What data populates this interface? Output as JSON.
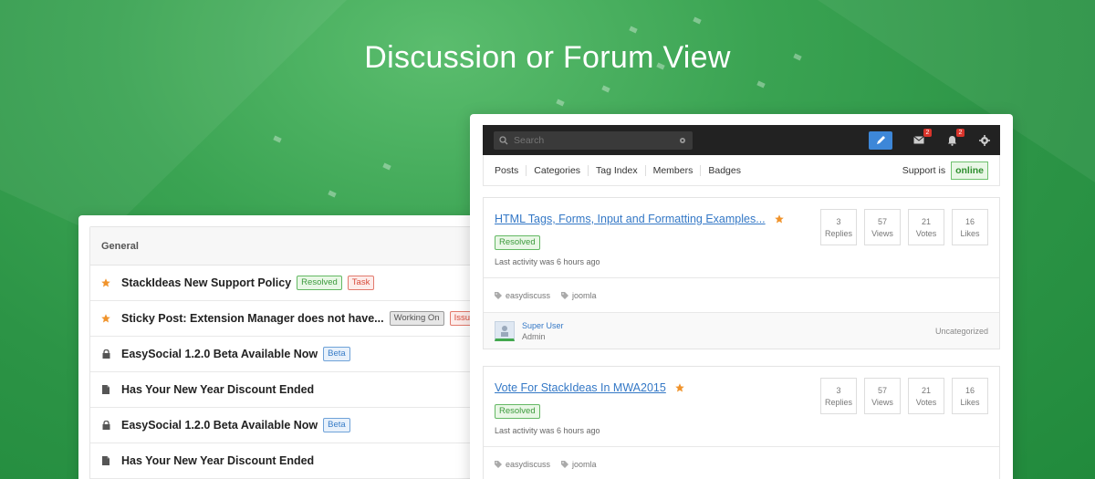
{
  "headline": "Discussion or Forum View",
  "left": {
    "header": "General",
    "rows": [
      {
        "icon": "star-icon",
        "title": "StackIdeas New Support Policy",
        "labels": [
          {
            "text": "Resolved",
            "kind": "resolved"
          },
          {
            "text": "Task",
            "kind": "task"
          }
        ]
      },
      {
        "icon": "star-icon",
        "title": "Sticky Post: Extension Manager does not have...",
        "labels": [
          {
            "text": "Working On",
            "kind": "working"
          },
          {
            "text": "Issue",
            "kind": "issue"
          }
        ]
      },
      {
        "icon": "lock-icon",
        "title": "EasySocial 1.2.0 Beta Available Now",
        "labels": [
          {
            "text": "Beta",
            "kind": "beta"
          }
        ]
      },
      {
        "icon": "document-icon",
        "title": "Has Your New Year Discount Ended",
        "labels": []
      },
      {
        "icon": "lock-icon",
        "title": "EasySocial 1.2.0 Beta Available Now",
        "labels": [
          {
            "text": "Beta",
            "kind": "beta"
          }
        ]
      },
      {
        "icon": "document-icon",
        "title": "Has Your New Year Discount Ended",
        "labels": []
      }
    ]
  },
  "toolbar": {
    "search_placeholder": "Search",
    "mail_count": "2",
    "notif_count": "2"
  },
  "subnav": {
    "items": [
      "Posts",
      "Categories",
      "Tag Index",
      "Members",
      "Badges"
    ],
    "support_label": "Support is",
    "support_status": "online"
  },
  "posts": [
    {
      "title": "HTML Tags, Forms, Input and Formatting Examples...",
      "status": "Resolved",
      "meta": "Last activity was 6 hours ago",
      "stats": [
        {
          "value": "3",
          "label": "Replies"
        },
        {
          "value": "57",
          "label": "Views"
        },
        {
          "value": "21",
          "label": "Votes"
        },
        {
          "value": "16",
          "label": "Likes"
        }
      ],
      "tags": [
        "easydiscuss",
        "joomla"
      ],
      "author_name": "Super User",
      "author_role": "Admin",
      "category": "Uncategorized"
    },
    {
      "title": "Vote For StackIdeas In MWA2015",
      "status": "Resolved",
      "meta": "Last activity was 6 hours ago",
      "stats": [
        {
          "value": "3",
          "label": "Replies"
        },
        {
          "value": "57",
          "label": "Views"
        },
        {
          "value": "21",
          "label": "Votes"
        },
        {
          "value": "16",
          "label": "Likes"
        }
      ],
      "tags": [
        "easydiscuss",
        "joomla"
      ]
    }
  ],
  "colors": {
    "accent_green": "#3aa352",
    "link_blue": "#3478c6",
    "star_orange": "#f0932b"
  }
}
